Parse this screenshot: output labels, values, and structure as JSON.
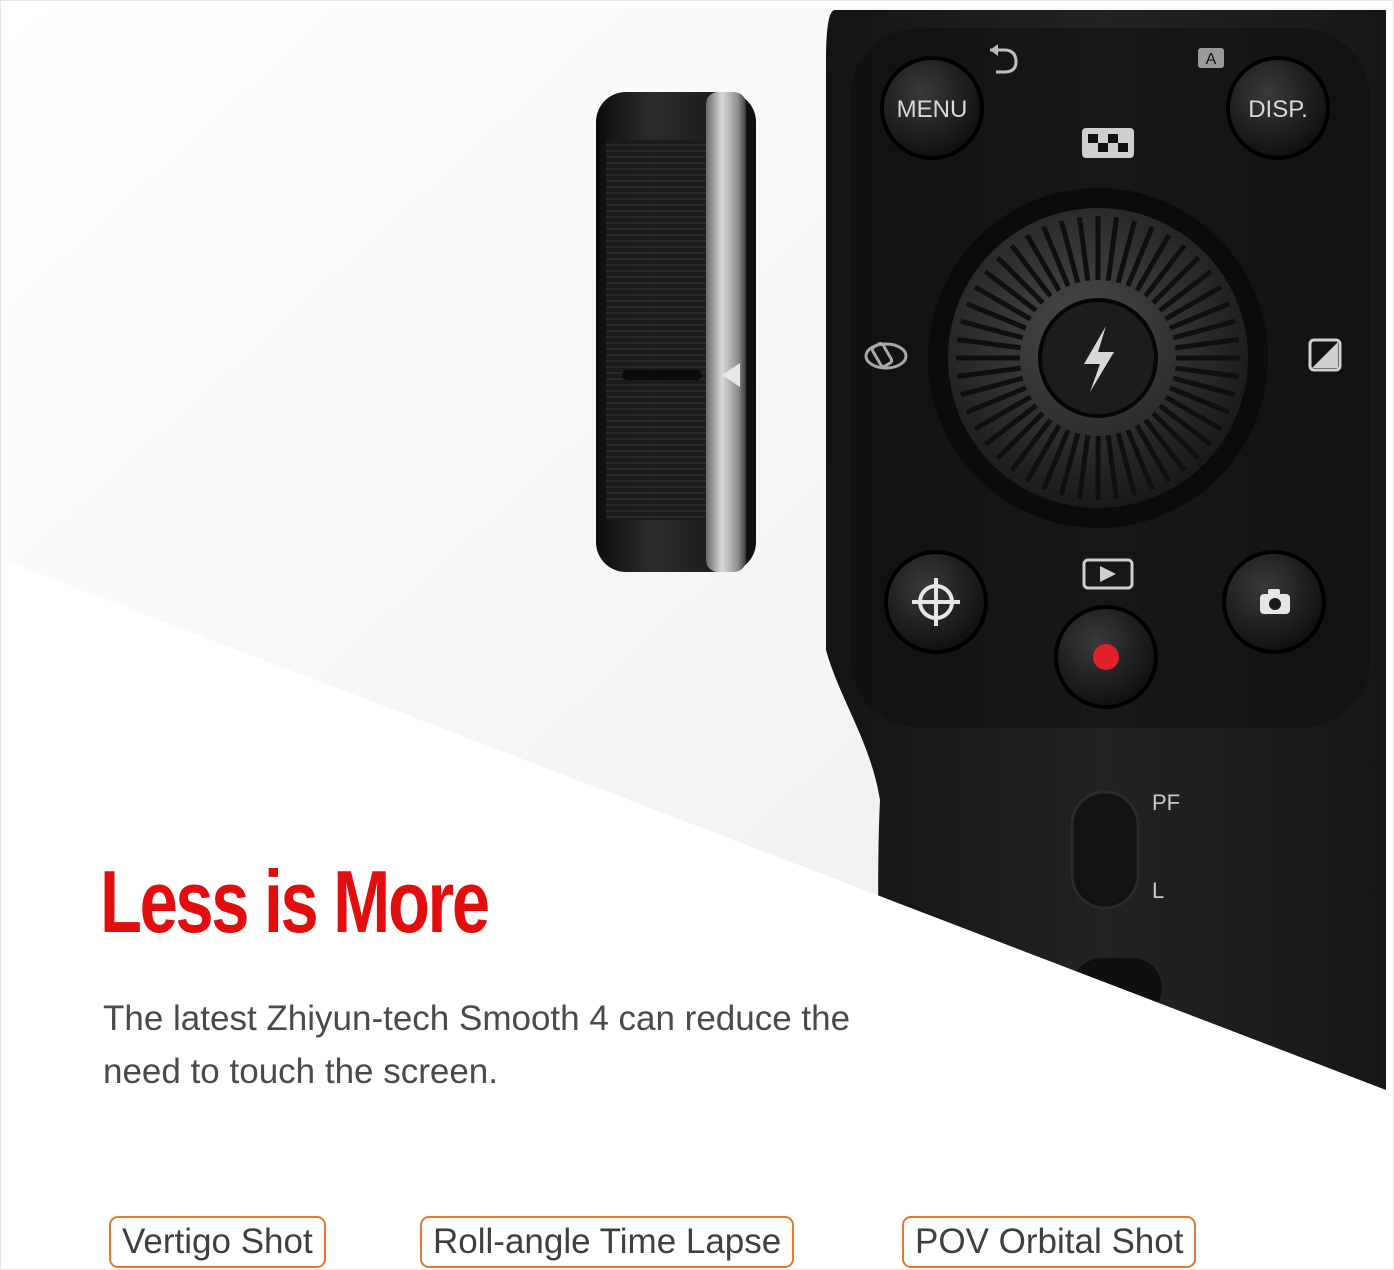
{
  "hero": {
    "headline": "Less is More",
    "description": "The latest Zhiyun-tech Smooth 4 can reduce the need to touch the screen."
  },
  "device": {
    "menu_label": "MENU",
    "disp_label": "DISP.",
    "pf_label": "PF",
    "l_label": "L",
    "mode_indicator": "A",
    "icons": [
      "back-arrow-icon",
      "checkerboard-icon",
      "flash-icon",
      "exposure-icon",
      "tracking-target-icon",
      "playback-icon",
      "camera-icon",
      "record-icon",
      "phone-rotate-icon"
    ],
    "record_color": "#e0202a"
  },
  "features": [
    "Vertigo Shot",
    "Roll-angle Time Lapse",
    "POV Orbital Shot"
  ],
  "colors": {
    "accent": "#e20d0d",
    "tag_border": "#e5772e",
    "body_text": "#4a4a4a"
  }
}
